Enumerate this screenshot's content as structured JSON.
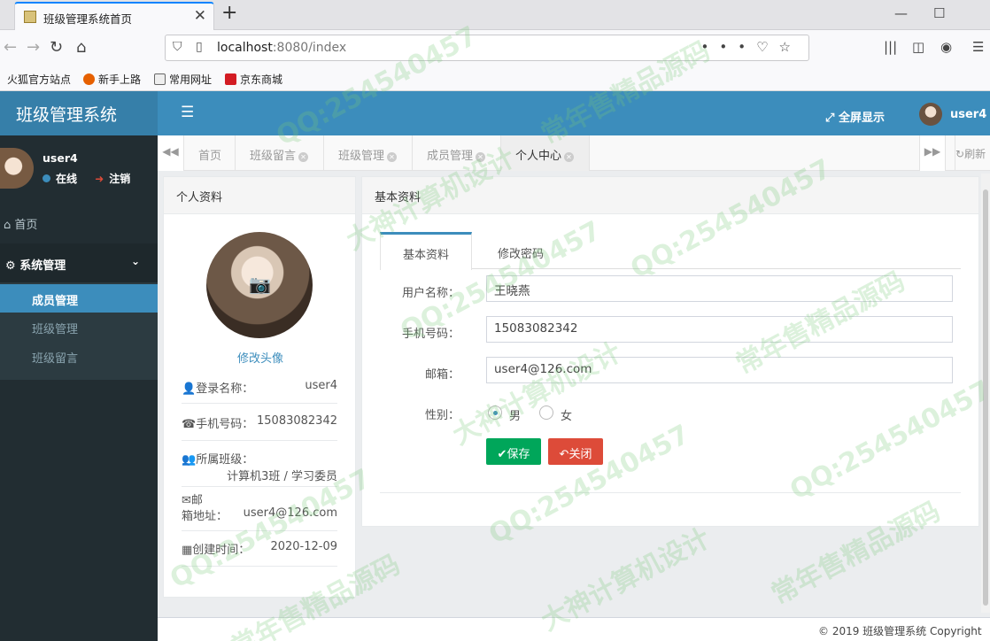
{
  "browser": {
    "tab_title": "班级管理系统首页",
    "url_host": "localhost",
    "url_rest": ":8080/index",
    "bookmarks": [
      "火狐官方站点",
      "新手上路",
      "常用网址",
      "京东商城"
    ]
  },
  "app": {
    "logo": "班级管理系统",
    "fullscreen_label": "全屏显示",
    "user": "user4"
  },
  "sidebar": {
    "user": "user4",
    "status_online": "在线",
    "logout": "注销",
    "home": "首页",
    "group": "系统管理",
    "items": [
      "成员管理",
      "班级管理",
      "班级留言"
    ]
  },
  "content_tabs": {
    "tabs": [
      "首页",
      "班级留言",
      "班级管理",
      "成员管理",
      "个人中心"
    ],
    "refresh": "刷新"
  },
  "profile": {
    "title": "个人资料",
    "change_avatar": "修改头像",
    "login_label": "登录名称：",
    "login_value": "user4",
    "phone_label": "手机号码：",
    "phone_value": "15083082342",
    "class_label": "所属班级：",
    "class_value": "计算机3班 / 学习委员",
    "email_label_1": "邮",
    "email_label_2": "箱地址：",
    "email_value": "user4@126.com",
    "created_label": "创建时间：",
    "created_value": "2020-12-09"
  },
  "basic": {
    "title": "基本资料",
    "tab_basic": "基本资料",
    "tab_password": "修改密码",
    "name_label": "用户名称：",
    "name_value": "王晓燕",
    "phone_label": "手机号码：",
    "phone_value": "15083082342",
    "email_label": "邮箱：",
    "email_value": "user4@126.com",
    "gender_label": "性别：",
    "gender_male": "男",
    "gender_female": "女",
    "save": "保存",
    "close": "关闭"
  },
  "footer": "© 2019 班级管理系统 Copyright",
  "watermarks": [
    "QQ:254540457",
    "常年售精品源码",
    "大神计算机设计"
  ],
  "colors": {
    "header": "#3c8dbc",
    "sidebar": "#222d32",
    "save": "#00a65a",
    "close": "#dd4b39"
  }
}
